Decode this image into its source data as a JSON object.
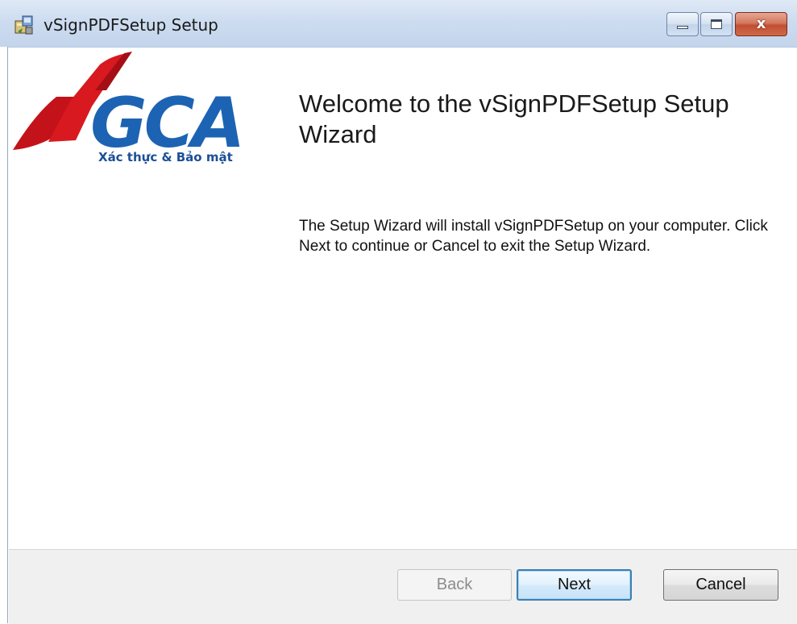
{
  "window": {
    "title": "vSignPDFSetup Setup",
    "app_icon": "installer-icon"
  },
  "caption_buttons": {
    "minimize_icon": "minimize-icon",
    "maximize_icon": "maximize-icon",
    "close_glyph": "x",
    "close_color": "#c14e33"
  },
  "logo": {
    "name": "vgca-logo",
    "wordmark": "VGCA",
    "tagline": "Xác thực & Bảo mật",
    "colors": {
      "red": "#c4121a",
      "blue": "#1d63b3"
    }
  },
  "content": {
    "heading": "Welcome to the vSignPDFSetup Setup Wizard",
    "description": "The Setup Wizard will install vSignPDFSetup on your computer. Click Next to continue or Cancel to exit the Setup Wizard."
  },
  "buttons": {
    "back_label": "Back",
    "back_enabled": false,
    "next_label": "Next",
    "cancel_label": "Cancel"
  }
}
